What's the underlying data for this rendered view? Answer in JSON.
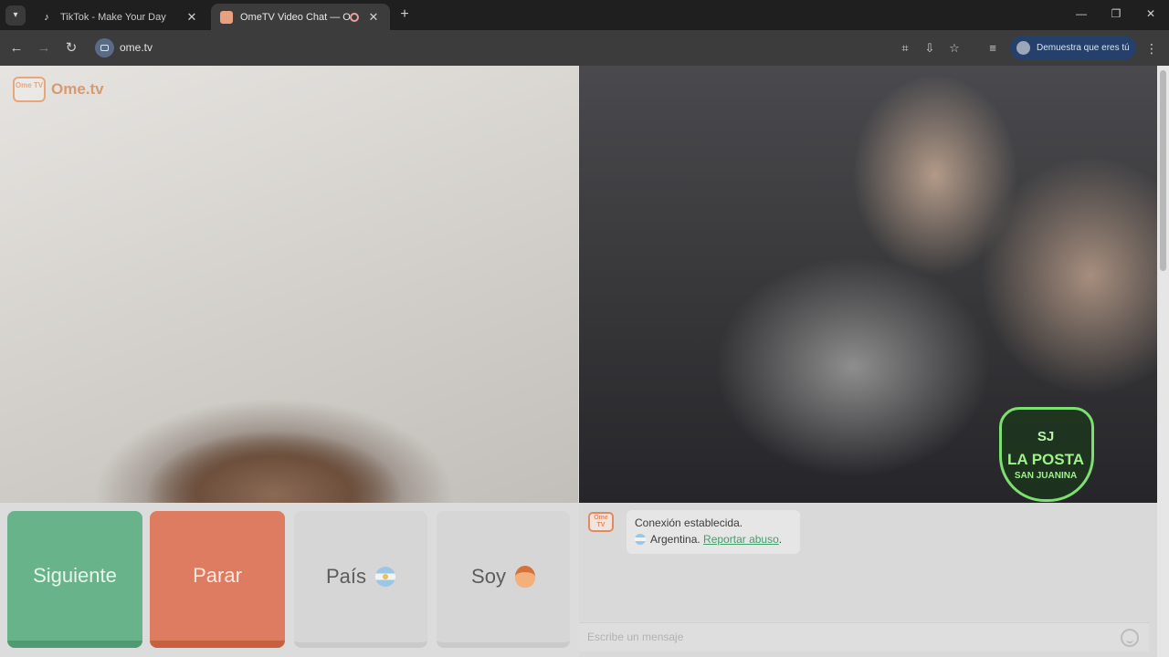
{
  "browser": {
    "tabs": [
      {
        "title": "TikTok - Make Your Day",
        "active": false
      },
      {
        "title": "OmeTV Video Chat — Ome",
        "active": true
      }
    ],
    "url": "ome.tv",
    "profile_label": "Demuestra que eres tú"
  },
  "site": {
    "logo_badge": "Ome TV",
    "logo_text": "Ome.tv"
  },
  "remote_video": {
    "overlay_badge": {
      "top": "SJ",
      "main": "LA POSTA",
      "sub": "SAN JUANINA"
    }
  },
  "controls": {
    "next_label": "Siguiente",
    "stop_label": "Parar",
    "country_label": "País",
    "gender_label": "Soy"
  },
  "chat": {
    "logo_badge": "Ome TV",
    "message_line1": "Conexión establecida.",
    "message_country": "Argentina.",
    "report_link": "Reportar abuso",
    "report_suffix": ".",
    "input_placeholder": "Escribe un mensaje"
  },
  "colors": {
    "next": "#69b38b",
    "stop": "#de7c62",
    "link": "#3fa06b",
    "profile_chip": "#25406a"
  }
}
